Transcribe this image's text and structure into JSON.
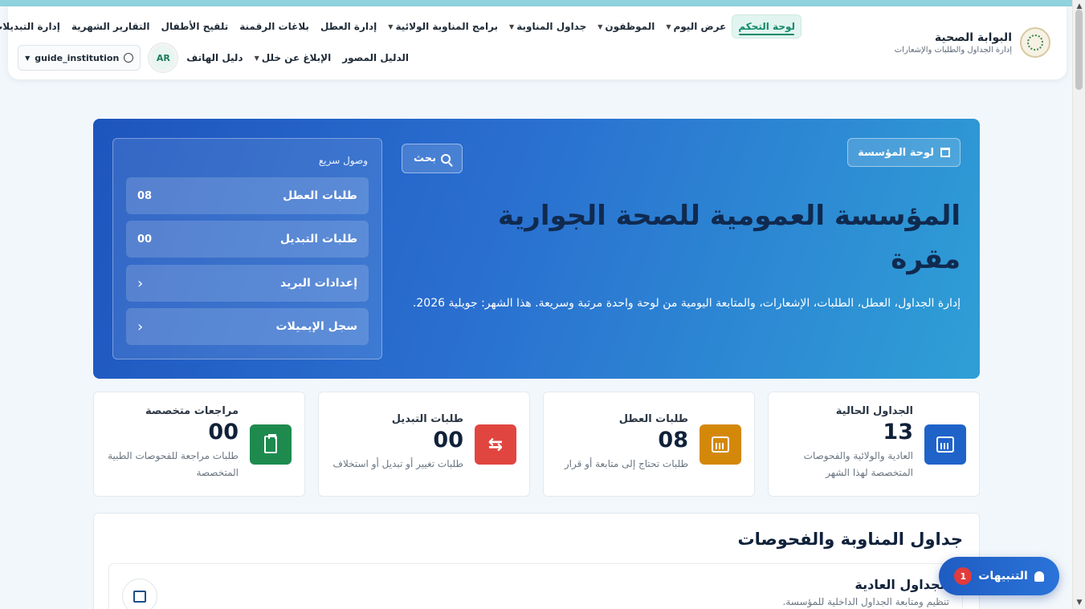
{
  "nav": {
    "brand_title": "البوابة الصحية",
    "brand_subtitle": "إدارة الجداول والطلبات والإشعارات",
    "row1": [
      {
        "label": "لوحة التحكم",
        "active": true,
        "caret": false
      },
      {
        "label": "عرض اليوم",
        "caret": true
      },
      {
        "label": "الموظفون",
        "caret": true
      },
      {
        "label": "جداول المناوبة",
        "caret": true
      },
      {
        "label": "برامج المناوبة الولائية",
        "caret": true
      },
      {
        "label": "إدارة العطل",
        "caret": false
      },
      {
        "label": "بلاغات الرقمنة",
        "caret": false
      },
      {
        "label": "تلقيح الأطفال",
        "caret": false
      },
      {
        "label": "التقارير الشهرية",
        "caret": false
      },
      {
        "label": "إدارة التبديلات",
        "caret": false
      }
    ],
    "row2": [
      {
        "label": "الدليل المصور",
        "caret": false
      },
      {
        "label": "الإبلاغ عن خلل",
        "caret": true
      },
      {
        "label": "دليل الهاتف",
        "caret": false
      }
    ],
    "lang_badge": "AR",
    "user": "guide_institution"
  },
  "hero": {
    "tag": "لوحة المؤسسة",
    "search": "بحث",
    "title": "المؤسسة العمومية للصحة الجوارية مقرة",
    "description": "إدارة الجداول، العطل، الطلبات، الإشعارات، والمتابعة اليومية من لوحة واحدة مرتبة وسريعة. هذا الشهر: جويلية 2026.",
    "quick_title": "وصول سريع",
    "quick_items": [
      {
        "label": "طلبات العطل",
        "value": "08"
      },
      {
        "label": "طلبات التبديل",
        "value": "00"
      },
      {
        "label": "إعدادات البريد",
        "value": ""
      },
      {
        "label": "سجل الإيميلات",
        "value": ""
      }
    ]
  },
  "stats": [
    {
      "title": "الجداول الحالية",
      "value": "13",
      "desc": "العادية والولائية والفحوصات المتخصصة لهذا الشهر",
      "color": "#1f63c9",
      "icon": "calendar-icon"
    },
    {
      "title": "طلبات العطل",
      "value": "08",
      "desc": "طلبات تحتاج إلى متابعة أو قرار",
      "color": "#d4880a",
      "icon": "calendar-check-icon"
    },
    {
      "title": "طلبات التبديل",
      "value": "00",
      "desc": "طلبات تغيير أو تبديل أو استخلاف",
      "color": "#e0463f",
      "icon": "swap-icon"
    },
    {
      "title": "مراجعات متخصصة",
      "value": "00",
      "desc": "طلبات مراجعة للفحوصات الطبية المتخصصة",
      "color": "#1e8a4e",
      "icon": "clipboard-icon"
    }
  ],
  "section": {
    "title": "جداول المناوبة والفحوصات",
    "card_title": "الجداول العادية",
    "card_desc": "تنظيم ومتابعة الجداول الداخلية للمؤسسة."
  },
  "notifications": {
    "label": "التنبيهات",
    "count": "1"
  }
}
